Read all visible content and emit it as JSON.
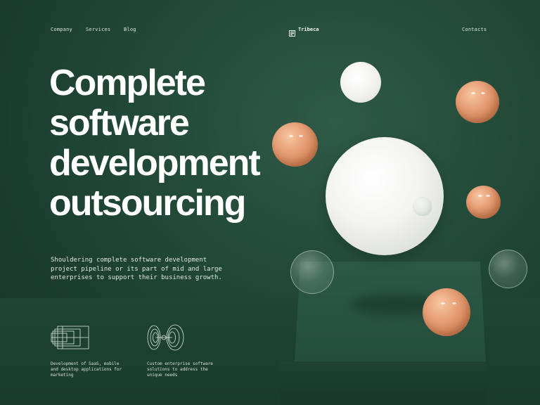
{
  "header": {
    "nav": [
      "Company",
      "Services",
      "Blog"
    ],
    "brand": {
      "name": "Tribeca",
      "icon": "tribeca-logo-icon"
    },
    "contacts": "Contacts"
  },
  "hero": {
    "title_lines": [
      "Complete",
      "software",
      "development",
      "outsourcing"
    ],
    "subtitle": "Shouldering complete software development project pipeline or its part of mid and large enterprises to support their business growth."
  },
  "features": [
    {
      "icon": "layered-rectangles-icon",
      "text": "Development of SaaS, mobile and desktop applications for marketing"
    },
    {
      "icon": "concentric-waves-icon",
      "text": "Custom enterprise software solutions to address the unique needs"
    }
  ],
  "colors": {
    "background": "#234a39",
    "text": "#ffffff",
    "accent_orange": "#e39a70",
    "sphere_white": "#f3f3f1"
  }
}
